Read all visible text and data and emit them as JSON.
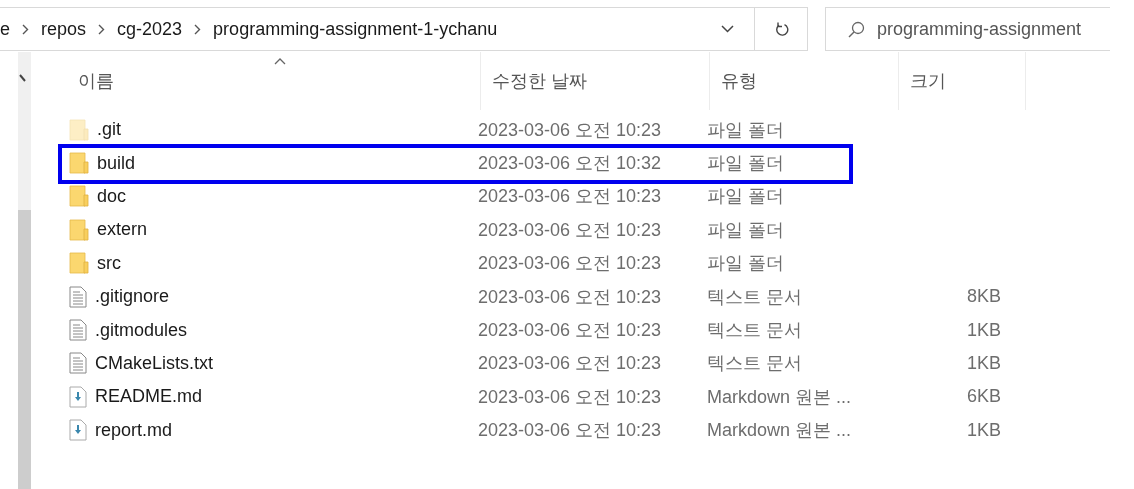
{
  "address_bar": {
    "breadcrumbs": [
      "e",
      "repos",
      "cg-2023",
      "programming-assignment-1-ychanu"
    ]
  },
  "search": {
    "placeholder": "programming-assignment"
  },
  "columns": [
    "이름",
    "수정한 날짜",
    "유형",
    "크기"
  ],
  "files": [
    {
      "kind": "folder",
      "name": ".git",
      "hidden": true,
      "highlighted": false,
      "modified": "2023-03-06 오전 10:23",
      "type": "파일 폴더"
    },
    {
      "kind": "folder",
      "name": "build",
      "hidden": false,
      "highlighted": true,
      "modified": "2023-03-06 오전 10:32",
      "type": "파일 폴더"
    },
    {
      "kind": "folder",
      "name": "doc",
      "hidden": false,
      "highlighted": false,
      "modified": "2023-03-06 오전 10:23",
      "type": "파일 폴더"
    },
    {
      "kind": "folder",
      "name": "extern",
      "hidden": false,
      "highlighted": false,
      "modified": "2023-03-06 오전 10:23",
      "type": "파일 폴더"
    },
    {
      "kind": "folder",
      "name": "src",
      "hidden": false,
      "highlighted": false,
      "modified": "2023-03-06 오전 10:23",
      "type": "파일 폴더"
    },
    {
      "kind": "text",
      "name": ".gitignore",
      "hidden": false,
      "highlighted": false,
      "modified": "2023-03-06 오전 10:23",
      "type": "텍스트 문서",
      "size": "8KB"
    },
    {
      "kind": "text",
      "name": ".gitmodules",
      "hidden": false,
      "highlighted": false,
      "modified": "2023-03-06 오전 10:23",
      "type": "텍스트 문서",
      "size": "1KB"
    },
    {
      "kind": "text",
      "name": "CMakeLists.txt",
      "hidden": false,
      "highlighted": false,
      "modified": "2023-03-06 오전 10:23",
      "type": "텍스트 문서",
      "size": "1KB"
    },
    {
      "kind": "markdown",
      "name": "README.md",
      "hidden": false,
      "highlighted": false,
      "modified": "2023-03-06 오전 10:23",
      "type": "Markdown 원본 ...",
      "size": "6KB"
    },
    {
      "kind": "markdown",
      "name": "report.md",
      "hidden": false,
      "highlighted": false,
      "modified": "2023-03-06 오전 10:23",
      "type": "Markdown 원본 ...",
      "size": "1KB"
    }
  ]
}
